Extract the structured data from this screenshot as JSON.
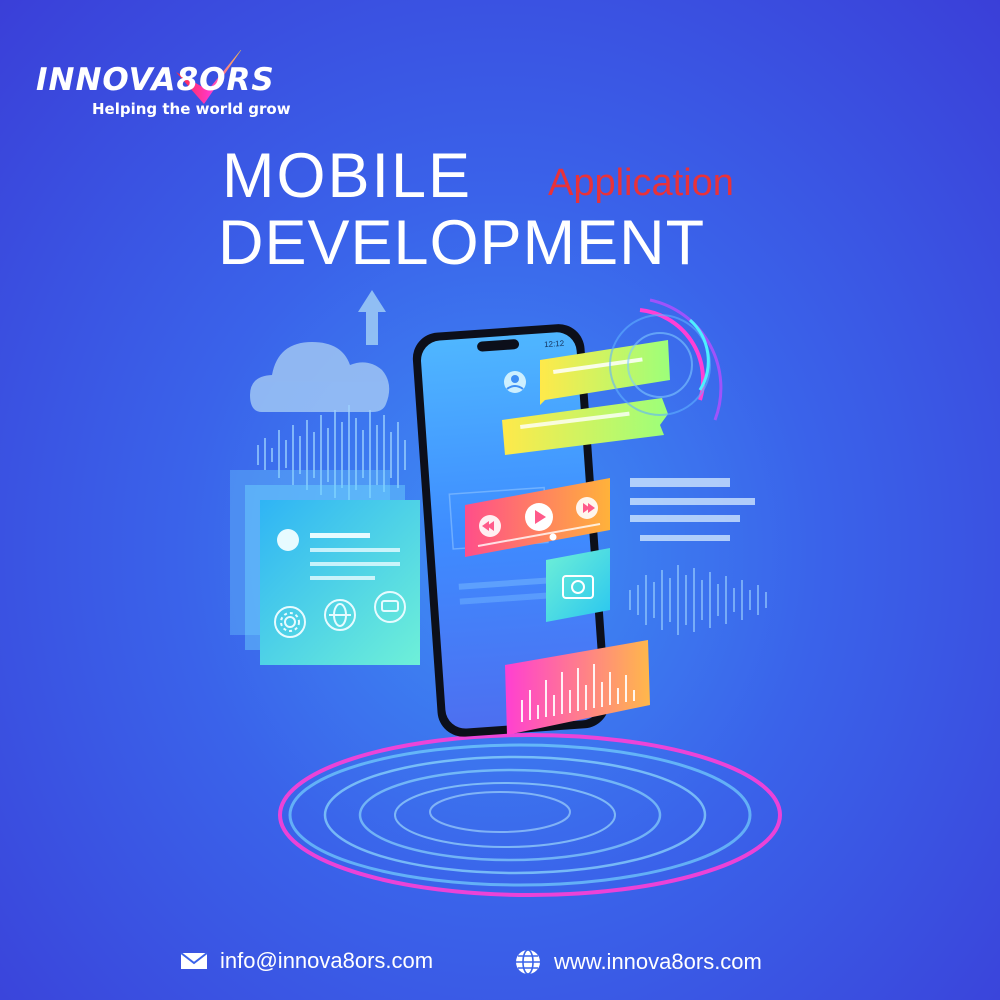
{
  "brand": {
    "logo_text": "INNOVA8ORS",
    "tagline": "Helping the world grow"
  },
  "headline": {
    "line1": "MOBILE",
    "accent": "Application",
    "line2": "DEVELOPMENT"
  },
  "phone": {
    "status_time": "12:12"
  },
  "footer": {
    "email": "info@innova8ors.com",
    "website": "www.innova8ors.com"
  },
  "icons": [
    "mail-icon",
    "globe-icon",
    "cloud-icon",
    "camera-icon",
    "gear-icon",
    "chat-icon",
    "play-icon",
    "rewind-icon",
    "fast-forward-icon",
    "user-icon"
  ]
}
